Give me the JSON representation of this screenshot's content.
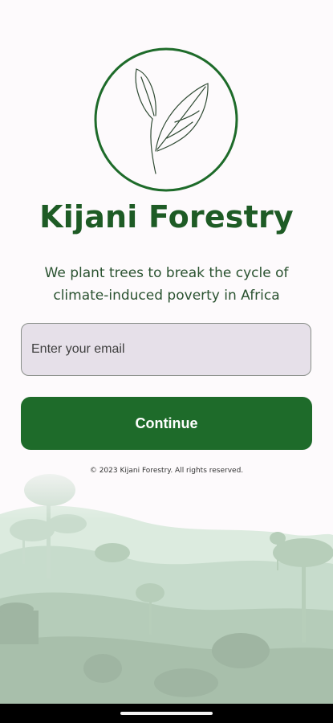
{
  "app": {
    "title": "Kijani Forestry",
    "tagline": "We plant trees to break the cycle of climate-induced poverty in Africa",
    "logo_icon": "leaf-icon"
  },
  "email": {
    "placeholder": "Enter your email",
    "value": ""
  },
  "actions": {
    "continue_label": "Continue"
  },
  "footer": {
    "copyright": "© 2023 Kijani Forestry. All rights reserved."
  },
  "colors": {
    "brand_green": "#1e6b2a",
    "title_green": "#1e5b25",
    "field_background": "#e6e0e9",
    "page_background": "#fdfafc"
  }
}
